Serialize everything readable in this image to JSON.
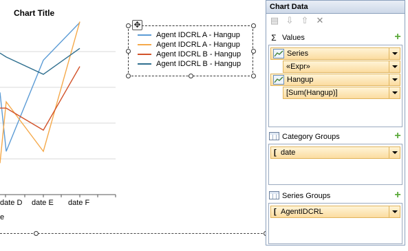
{
  "chart": {
    "title": "Chart Title",
    "axis_title_fragment": "e"
  },
  "chart_data": {
    "type": "line",
    "title": "Chart Title",
    "categories": [
      "date D",
      "date E",
      "date F"
    ],
    "series": [
      {
        "name": "Agent IDCRL A - Hangup",
        "color": "#5b9bd5",
        "values": [
          55,
          171,
          219
        ]
      },
      {
        "name": "Agent IDCRL A - Hangup",
        "color": "#f5a94a",
        "values": [
          118,
          55,
          220
        ]
      },
      {
        "name": "Agent IDCRL B - Hangup",
        "color": "#d2532a",
        "values": [
          110,
          82,
          163
        ]
      },
      {
        "name": "Agent IDCRL B - Hangup",
        "color": "#2f6f8f",
        "values": [
          175,
          153,
          186
        ]
      }
    ],
    "ylim": [
      0,
      230
    ],
    "grid": true,
    "legend_position": "top-right"
  },
  "panel": {
    "title": "Chart Data",
    "sections": {
      "values": {
        "label": "Values",
        "rows": [
          {
            "text": "Series",
            "kind": "series"
          },
          {
            "text": "«Expr»",
            "kind": "expr"
          },
          {
            "text": "Hangup",
            "kind": "series"
          },
          {
            "text": "[Sum(Hangup)]",
            "kind": "expr"
          }
        ]
      },
      "category_groups": {
        "label": "Category Groups",
        "rows": [
          {
            "text": "date"
          }
        ]
      },
      "series_groups": {
        "label": "Series Groups",
        "rows": [
          {
            "text": "AgentIDCRL"
          }
        ]
      }
    },
    "toolbar_icons": [
      "properties-icon",
      "move-down-icon",
      "move-up-icon",
      "delete-icon"
    ]
  }
}
